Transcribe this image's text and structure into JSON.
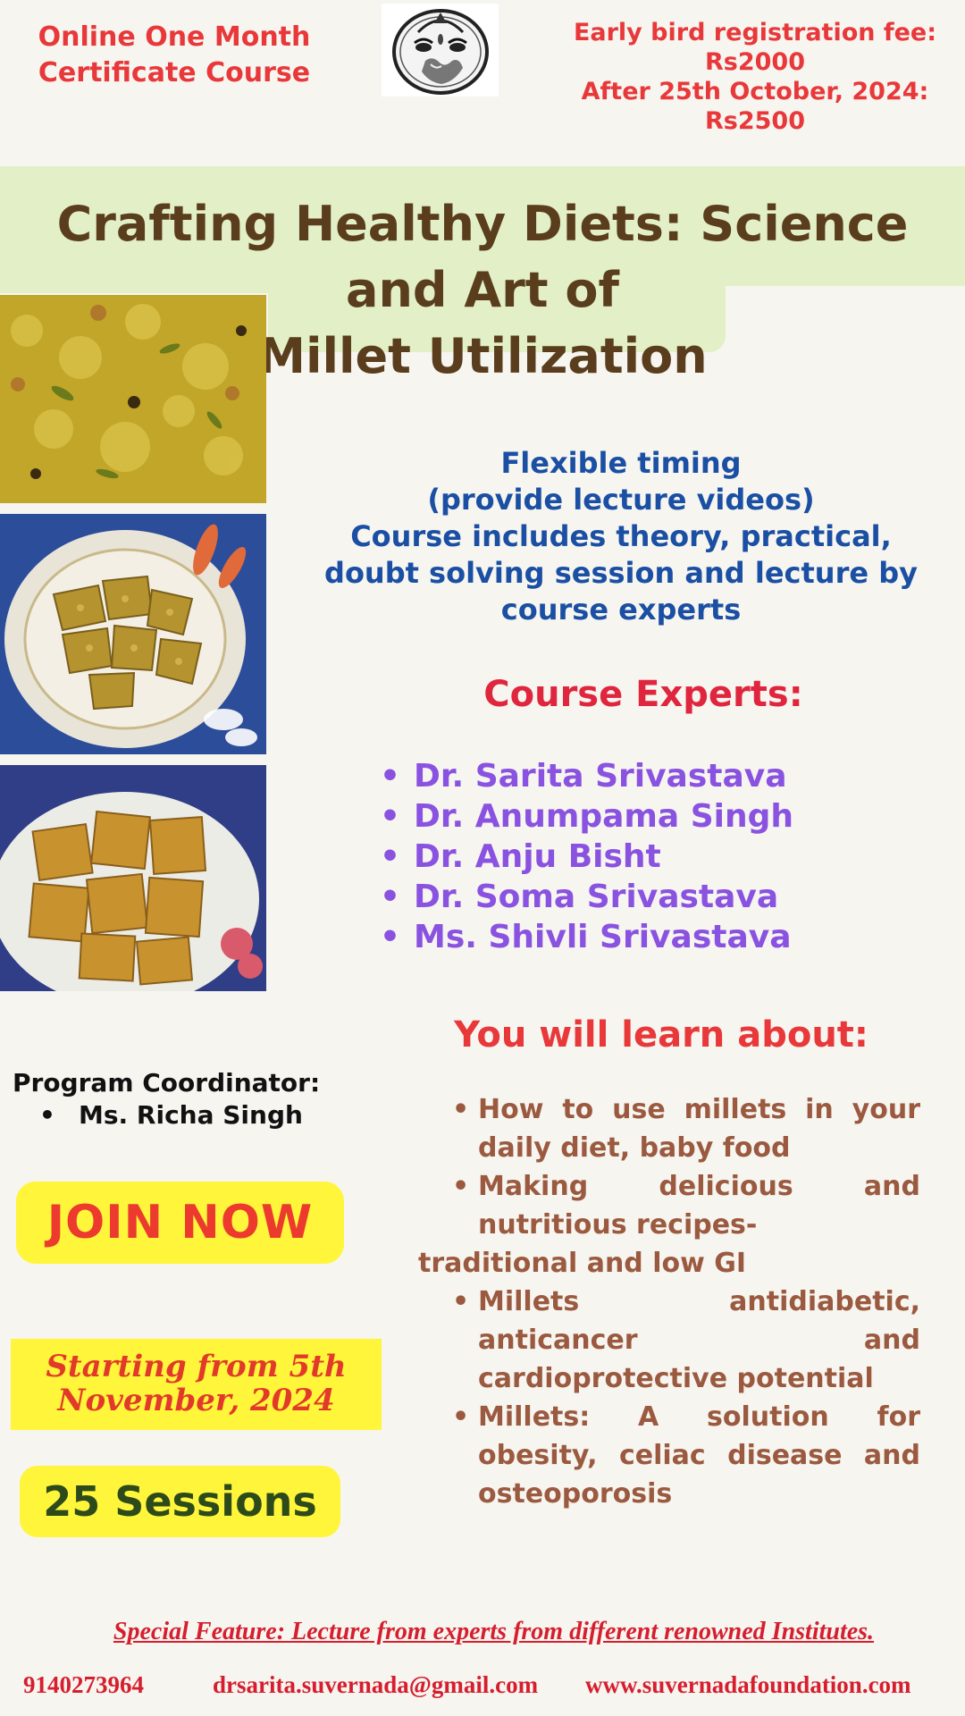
{
  "header": {
    "left_lines": [
      "Online One Month",
      "Certificate Course"
    ],
    "right_lines": [
      "Early bird registration fee:",
      "Rs2000",
      "After 25th October, 2024:",
      "Rs2500"
    ]
  },
  "title": {
    "line1": "Crafting Healthy Diets: Science and Art of",
    "line2": "Millet Utilization"
  },
  "info_lines": [
    "Flexible timing",
    "(provide lecture videos)",
    "Course includes theory, practical,",
    "doubt solving session and lecture by",
    "course experts"
  ],
  "experts": {
    "title": "Course Experts:",
    "names": [
      "Dr. Sarita Srivastava",
      "Dr. Anumpama Singh",
      "Dr. Anju Bisht",
      "Dr. Soma Srivastava",
      "Ms. Shivli Srivastava"
    ]
  },
  "coordinator": {
    "label": "Program Coordinator:",
    "name": "Ms. Richa Singh"
  },
  "join_label": "JOIN NOW",
  "start_lines": [
    "Starting from 5th",
    "November, 2024"
  ],
  "sessions_label": "25 Sessions",
  "learn": {
    "title": "You will learn about:",
    "items": [
      "How to use millets in your daily diet, baby food",
      "Making delicious and nutritious recipes-",
      "traditional and low GI",
      "Millets antidiabetic, anticancer and cardioprotective potential",
      " Millets: A solution for obesity, celiac disease and osteoporosis"
    ]
  },
  "footer": {
    "special": "Special Feature: Lecture from experts from different renowned Institutes.",
    "phone": "9140273964",
    "email": "drsarita.suvernada@gmail.com",
    "website": "www.suvernadafoundation.com"
  },
  "icons": {
    "logo": "goddess-globe-logo"
  },
  "colors": {
    "accent_red": "#e8383a",
    "banner_green": "#e3f0c7",
    "info_blue": "#1a4fa3",
    "expert_purple": "#8a52e0",
    "learn_brown": "#9b5a40",
    "highlight_yellow": "#fff53a"
  }
}
